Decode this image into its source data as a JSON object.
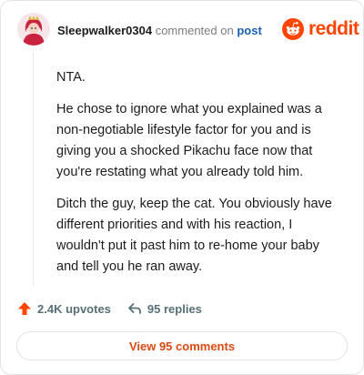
{
  "header": {
    "username": "Sleepwalker0304",
    "action_text": "commented on",
    "post_link": "post"
  },
  "brand": {
    "name": "reddit",
    "color": "#ff4500",
    "icon": "reddit-alien-icon"
  },
  "comment": {
    "paragraphs": [
      "NTA.",
      "He chose to ignore what you explained was a non-negotiable lifestyle factor for you and is giving you a shocked Pikachu face now that you're restating what you already told him.",
      "Ditch the guy, keep the cat. You obviously have different priorities and with his reaction, I wouldn't put it past him to re-home your baby and tell you he ran away."
    ]
  },
  "stats": {
    "upvotes": "2.4K upvotes",
    "upvote_icon": "upvote-arrow-icon",
    "upvote_color": "#ff4500",
    "replies": "95 replies",
    "reply_icon": "reply-arrow-icon"
  },
  "view_button": {
    "label": "View 95 comments",
    "color": "#d94a12"
  }
}
